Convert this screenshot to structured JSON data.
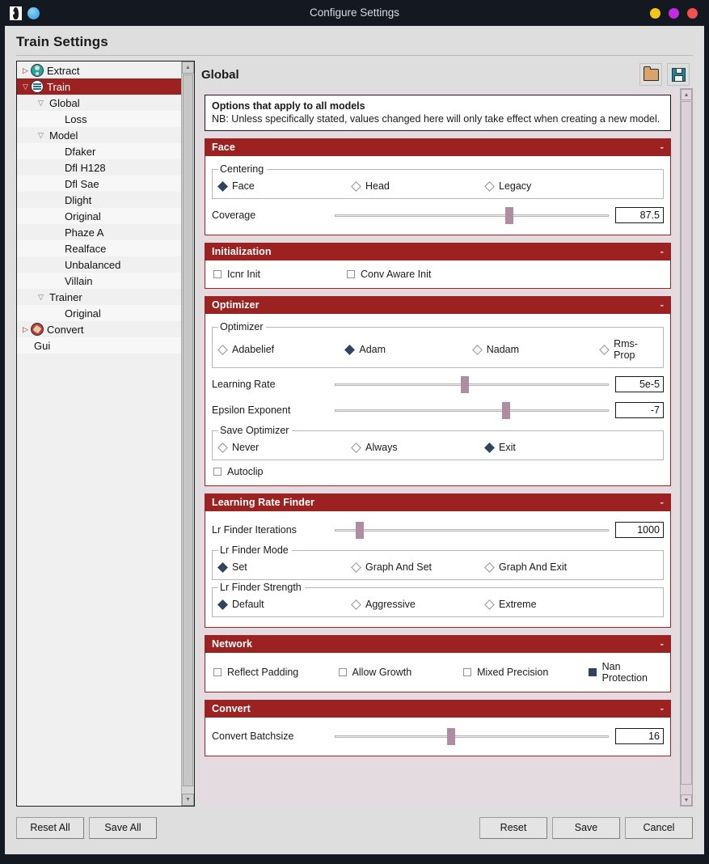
{
  "titlebar": {
    "title": "Configure Settings",
    "app_icon": "faceswap-icon",
    "second_icon": "blue-circle-icon",
    "buttons": [
      {
        "name": "minimize-button",
        "color": "#f5c518"
      },
      {
        "name": "maximize-button",
        "color": "#c42ae0"
      },
      {
        "name": "close-button",
        "color": "#f4514d"
      }
    ]
  },
  "page": {
    "title": "Train Settings"
  },
  "sidebar": {
    "items": [
      {
        "label": "Extract",
        "indent": 0,
        "arrow": "collapsed",
        "icon": "extract-icon",
        "selected": false
      },
      {
        "label": "Train",
        "indent": 0,
        "arrow": "expanded",
        "icon": "train-icon",
        "selected": true
      },
      {
        "label": "Global",
        "indent": 1,
        "arrow": "expanded",
        "icon": "",
        "selected": false
      },
      {
        "label": "Loss",
        "indent": 2,
        "arrow": "",
        "icon": "",
        "selected": false
      },
      {
        "label": "Model",
        "indent": 1,
        "arrow": "expanded",
        "icon": "",
        "selected": false
      },
      {
        "label": "Dfaker",
        "indent": 2,
        "arrow": "",
        "icon": "",
        "selected": false
      },
      {
        "label": "Dfl H128",
        "indent": 2,
        "arrow": "",
        "icon": "",
        "selected": false
      },
      {
        "label": "Dfl Sae",
        "indent": 2,
        "arrow": "",
        "icon": "",
        "selected": false
      },
      {
        "label": "Dlight",
        "indent": 2,
        "arrow": "",
        "icon": "",
        "selected": false
      },
      {
        "label": "Original",
        "indent": 2,
        "arrow": "",
        "icon": "",
        "selected": false
      },
      {
        "label": "Phaze A",
        "indent": 2,
        "arrow": "",
        "icon": "",
        "selected": false
      },
      {
        "label": "Realface",
        "indent": 2,
        "arrow": "",
        "icon": "",
        "selected": false
      },
      {
        "label": "Unbalanced",
        "indent": 2,
        "arrow": "",
        "icon": "",
        "selected": false
      },
      {
        "label": "Villain",
        "indent": 2,
        "arrow": "",
        "icon": "",
        "selected": false
      },
      {
        "label": "Trainer",
        "indent": 1,
        "arrow": "expanded",
        "icon": "",
        "selected": false
      },
      {
        "label": "Original",
        "indent": 2,
        "arrow": "",
        "icon": "",
        "selected": false
      },
      {
        "label": "Convert",
        "indent": 0,
        "arrow": "collapsed",
        "icon": "convert-icon",
        "selected": false
      },
      {
        "label": "Gui",
        "indent": 0,
        "arrow": "",
        "icon": "",
        "selected": false
      }
    ]
  },
  "content": {
    "heading": "Global",
    "toolbar": {
      "open_icon": "folder-open-icon",
      "save_icon": "floppy-save-icon"
    },
    "info": {
      "line1": "Options that apply to all models",
      "line2": "NB: Unless specifically stated, values changed here will only take effect when creating a new model."
    },
    "collapse_glyph": "-",
    "sections": [
      {
        "title": "Face",
        "groups": [
          {
            "legend": "Centering",
            "options": [
              {
                "label": "Face",
                "selected": true
              },
              {
                "label": "Head",
                "selected": false
              },
              {
                "label": "Legacy",
                "selected": false
              }
            ]
          }
        ],
        "sliders": [
          {
            "label": "Coverage",
            "value": "87.5",
            "pct": 63.5
          }
        ],
        "checks": []
      },
      {
        "title": "Initialization",
        "groups": [],
        "sliders": [],
        "checks": [
          {
            "label": "Icnr Init",
            "checked": false
          },
          {
            "label": "Conv Aware Init",
            "checked": false
          }
        ]
      },
      {
        "title": "Optimizer",
        "groups": [
          {
            "legend": "Optimizer",
            "options": [
              {
                "label": "Adabelief",
                "selected": false
              },
              {
                "label": "Adam",
                "selected": true
              },
              {
                "label": "Nadam",
                "selected": false
              },
              {
                "label": "Rms-Prop",
                "selected": false
              }
            ]
          }
        ],
        "sliders": [
          {
            "label": "Learning Rate",
            "value": "5e-5",
            "pct": 47.5
          },
          {
            "label": "Epsilon Exponent",
            "value": "-7",
            "pct": 62.5
          }
        ],
        "groups2": [
          {
            "legend": "Save Optimizer",
            "options": [
              {
                "label": "Never",
                "selected": false
              },
              {
                "label": "Always",
                "selected": false
              },
              {
                "label": "Exit",
                "selected": true
              }
            ]
          }
        ],
        "checks": [
          {
            "label": "Autoclip",
            "checked": false
          }
        ]
      },
      {
        "title": "Learning Rate Finder",
        "sliders": [
          {
            "label": "Lr Finder Iterations",
            "value": "1000",
            "pct": 9.5
          }
        ],
        "groups": [
          {
            "legend": "Lr Finder Mode",
            "options": [
              {
                "label": "Set",
                "selected": true
              },
              {
                "label": "Graph And Set",
                "selected": false
              },
              {
                "label": "Graph And Exit",
                "selected": false
              }
            ]
          },
          {
            "legend": "Lr Finder Strength",
            "options": [
              {
                "label": "Default",
                "selected": true
              },
              {
                "label": "Aggressive",
                "selected": false
              },
              {
                "label": "Extreme",
                "selected": false
              }
            ]
          }
        ],
        "checks": []
      },
      {
        "title": "Network",
        "groups": [],
        "sliders": [],
        "checks": [
          {
            "label": "Reflect Padding",
            "checked": false
          },
          {
            "label": "Allow Growth",
            "checked": false
          },
          {
            "label": "Mixed Precision",
            "checked": false
          },
          {
            "label": "Nan Protection",
            "checked": true
          }
        ]
      },
      {
        "title": "Convert",
        "groups": [],
        "sliders": [
          {
            "label": "Convert Batchsize",
            "value": "16",
            "pct": 42.5
          }
        ],
        "checks": []
      }
    ]
  },
  "footer": {
    "left": [
      {
        "label": "Reset All",
        "name": "reset-all-button"
      },
      {
        "label": "Save All",
        "name": "save-all-button"
      }
    ],
    "right": [
      {
        "label": "Reset",
        "name": "reset-button"
      },
      {
        "label": "Save",
        "name": "save-button"
      },
      {
        "label": "Cancel",
        "name": "cancel-button"
      }
    ]
  },
  "colors": {
    "accent_red": "#9c2222",
    "slider_thumb": "#b08ca3",
    "panel_bg": "#e4dbe0",
    "radio_on": "#2e4561"
  }
}
